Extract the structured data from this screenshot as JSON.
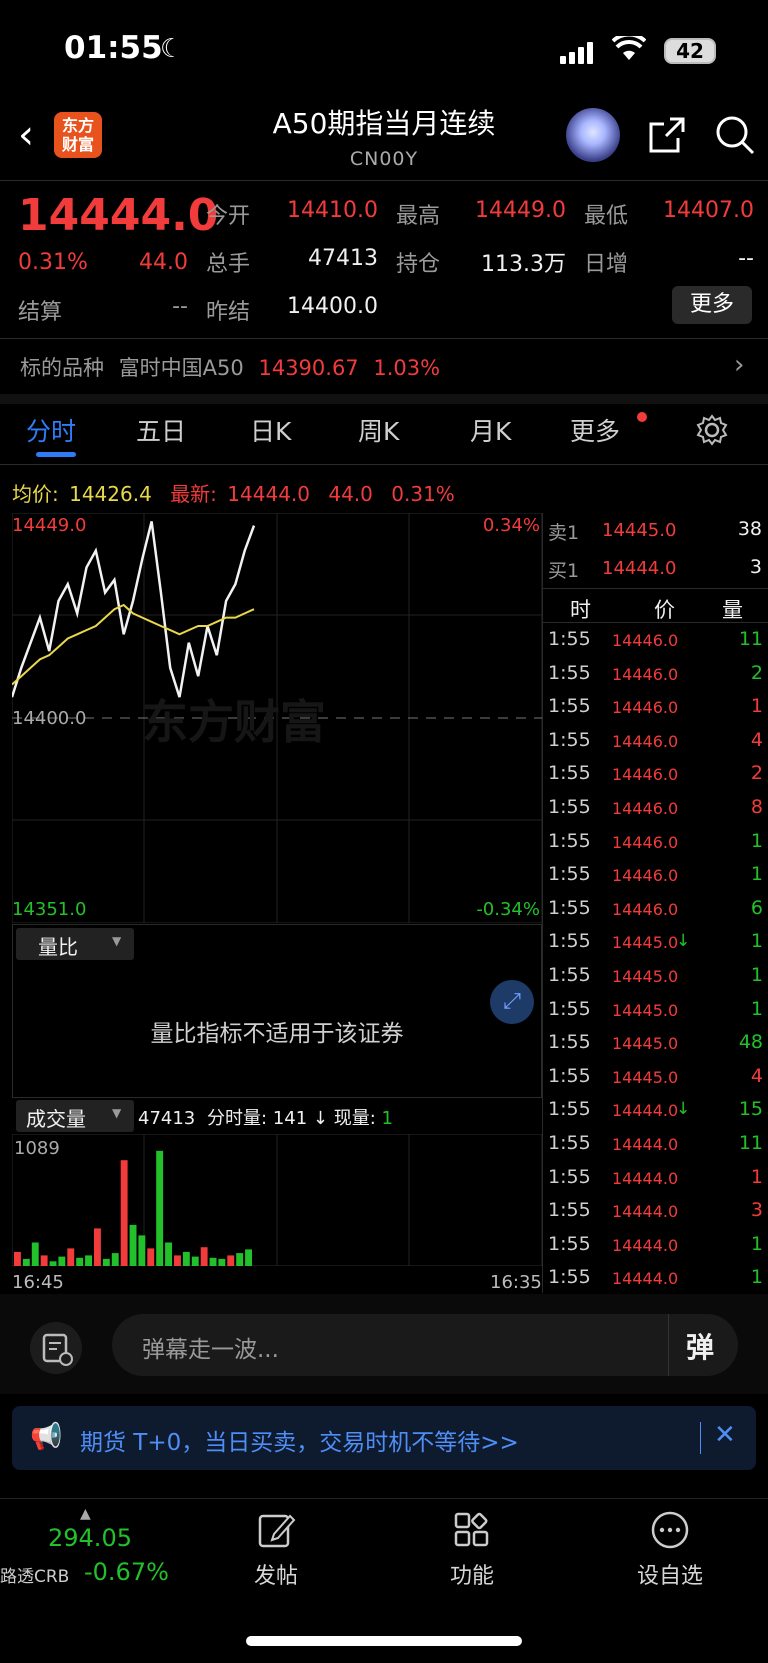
{
  "status": {
    "time": "01:55",
    "battery": "42"
  },
  "header": {
    "logo_line1": "东方",
    "logo_line2": "财富",
    "title": "A50期指当月连续",
    "code": "CN00Y"
  },
  "quote": {
    "price": "14444.0",
    "change_pct": "0.31%",
    "change": "44.0",
    "open_label": "今开",
    "open": "14410.0",
    "high_label": "最高",
    "high": "14449.0",
    "low_label": "最低",
    "low": "14407.0",
    "volume_label": "总手",
    "volume": "47413",
    "oi_label": "持仓",
    "oi": "113.3万",
    "daily_inc_label": "日增",
    "daily_inc": "--",
    "settle_label": "结算",
    "settle": "--",
    "prev_settle_label": "昨结",
    "prev_settle": "14400.0",
    "more": "更多"
  },
  "underlying": {
    "label": "标的品种",
    "name": "富时中国A50",
    "price": "14390.67",
    "pct": "1.03%"
  },
  "tabs": [
    "分时",
    "五日",
    "日K",
    "周K",
    "月K",
    "更多"
  ],
  "info": {
    "avg_label": "均价:",
    "avg": "14426.4",
    "latest_label": "最新:",
    "latest": "14444.0",
    "chg": "44.0",
    "pct": "0.31%"
  },
  "chart": {
    "high_label": "14449.0",
    "high_pct": "0.34%",
    "mid_label": "14400.0",
    "low_label": "14351.0",
    "low_pct": "-0.34%",
    "watermark": "东方财富",
    "ratio_label": "量比",
    "ratio_msg": "量比指标不适用于该证券",
    "vol_label": "成交量",
    "vol_total": "47413",
    "vol_fs_label": "分时量:",
    "vol_fs": "141",
    "vol_now_label": "现量:",
    "vol_now": "1",
    "vol_max": "1089",
    "time_start": "16:45",
    "time_end": "16:35"
  },
  "orderbook": {
    "sell_label": "卖1",
    "sell_price": "14445.0",
    "sell_qty": "38",
    "buy_label": "买1",
    "buy_price": "14444.0",
    "buy_qty": "3"
  },
  "ticks_header": {
    "time": "时",
    "price": "价",
    "qty": "量"
  },
  "ticks": [
    {
      "t": "1:55",
      "p": "14446.0",
      "q": "11",
      "c": "green",
      "arrow": ""
    },
    {
      "t": "1:55",
      "p": "14446.0",
      "q": "2",
      "c": "green",
      "arrow": ""
    },
    {
      "t": "1:55",
      "p": "14446.0",
      "q": "1",
      "c": "red",
      "arrow": ""
    },
    {
      "t": "1:55",
      "p": "14446.0",
      "q": "4",
      "c": "red",
      "arrow": ""
    },
    {
      "t": "1:55",
      "p": "14446.0",
      "q": "2",
      "c": "red",
      "arrow": ""
    },
    {
      "t": "1:55",
      "p": "14446.0",
      "q": "8",
      "c": "red",
      "arrow": ""
    },
    {
      "t": "1:55",
      "p": "14446.0",
      "q": "1",
      "c": "green",
      "arrow": ""
    },
    {
      "t": "1:55",
      "p": "14446.0",
      "q": "1",
      "c": "green",
      "arrow": ""
    },
    {
      "t": "1:55",
      "p": "14446.0",
      "q": "6",
      "c": "green",
      "arrow": ""
    },
    {
      "t": "1:55",
      "p": "14445.0",
      "q": "1",
      "c": "green",
      "arrow": "↓"
    },
    {
      "t": "1:55",
      "p": "14445.0",
      "q": "1",
      "c": "green",
      "arrow": ""
    },
    {
      "t": "1:55",
      "p": "14445.0",
      "q": "1",
      "c": "green",
      "arrow": ""
    },
    {
      "t": "1:55",
      "p": "14445.0",
      "q": "48",
      "c": "green",
      "arrow": ""
    },
    {
      "t": "1:55",
      "p": "14445.0",
      "q": "4",
      "c": "red",
      "arrow": ""
    },
    {
      "t": "1:55",
      "p": "14444.0",
      "q": "15",
      "c": "green",
      "arrow": "↓"
    },
    {
      "t": "1:55",
      "p": "14444.0",
      "q": "11",
      "c": "green",
      "arrow": ""
    },
    {
      "t": "1:55",
      "p": "14444.0",
      "q": "1",
      "c": "red",
      "arrow": ""
    },
    {
      "t": "1:55",
      "p": "14444.0",
      "q": "3",
      "c": "red",
      "arrow": ""
    },
    {
      "t": "1:55",
      "p": "14444.0",
      "q": "1",
      "c": "green",
      "arrow": ""
    },
    {
      "t": "1:55",
      "p": "14444.0",
      "q": "1",
      "c": "green",
      "arrow": ""
    }
  ],
  "danmu": {
    "placeholder": "弹幕走一波...",
    "btn": "弹"
  },
  "banner": {
    "text": "期货 T+0，当日买卖，交易时机不等待>>"
  },
  "bottom": {
    "index_value": "294.05",
    "index_name": "路透CRB",
    "index_pct": "-0.67%",
    "post": "发帖",
    "func": "功能",
    "watchlist": "设自选"
  },
  "chart_data": {
    "type": "line",
    "title": "",
    "ylim": [
      14351.0,
      14449.0
    ],
    "series": [
      {
        "values": [
          14405,
          14412,
          14418,
          14424,
          14416,
          14428,
          14432,
          14425,
          14436,
          14440,
          14430,
          14433,
          14420,
          14428,
          14438,
          14447,
          14430,
          14412,
          14405,
          14418,
          14410,
          14422,
          14415,
          14428,
          14432,
          14440,
          14446
        ]
      },
      {
        "values": [
          14408,
          14410,
          14412,
          14414,
          14415,
          14417,
          14419,
          14420,
          14421,
          14422,
          14424,
          14426,
          14427,
          14425,
          14424,
          14423,
          14422,
          14421,
          14420,
          14421,
          14422,
          14422,
          14423,
          14424,
          14424,
          14425,
          14426
        ]
      }
    ],
    "volume": [
      120,
      60,
      200,
      90,
      40,
      80,
      150,
      70,
      90,
      320,
      60,
      110,
      900,
      350,
      260,
      150,
      980,
      200,
      90,
      120,
      80,
      160,
      70,
      60,
      90,
      110,
      141
    ]
  }
}
